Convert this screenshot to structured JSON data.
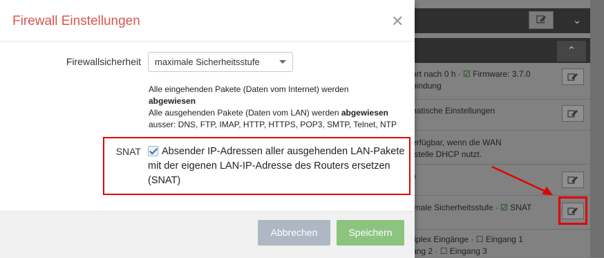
{
  "modal": {
    "title": "Firewall Einstellungen",
    "close_icon": "close-icon",
    "firewall_label": "Firewallsicherheit",
    "firewall_select": "maximale Sicherheitsstufe",
    "desc_line1": "Alle eingehenden Pakete (Daten vom Internet) werden",
    "desc_line2": "abgewiesen",
    "desc_line3a": "Alle ausgehenden Pakete (Daten vom LAN) werden ",
    "desc_line3b": "abgewiesen",
    "desc_line4": "ausser: DNS, FTP, IMAP, HTTP, HTTPS, POP3, SMTP, Telnet, NTP",
    "snat_label": "SNAT",
    "snat_checked": true,
    "snat_text": "Absender IP-Adressen aller ausgehenden LAN-Pakete mit der eigenen LAN-IP-Adresse des Routers ersetzen (SNAT)",
    "cancel_label": "Abbrechen",
    "save_label": "Speichern"
  },
  "background": {
    "row1_line1_a": "art nach 0 h  · ",
    "row1_line1_b": "Firmware: 3.7.0",
    "row1_line2": "bindung",
    "row2_line1": "natische Einstellungen",
    "row3_line1": "erfügbar, wenn die WAN",
    "row3_line2": "tstelle DHCP nutzt.",
    "row4_line1": "v",
    "row5_line1_a": "imale Sicherheitsstufe  · ",
    "row5_line1_b": "SNAT",
    "row6_line1": "tiplex Eingänge  · ☐ Eingang 1",
    "row6_line2": "ang 2  · ☐ Eingang 3"
  },
  "colors": {
    "title": "#d9534f",
    "save": "#8cc47f",
    "cancel": "#aeb8c2",
    "annotation": "#e00000"
  }
}
